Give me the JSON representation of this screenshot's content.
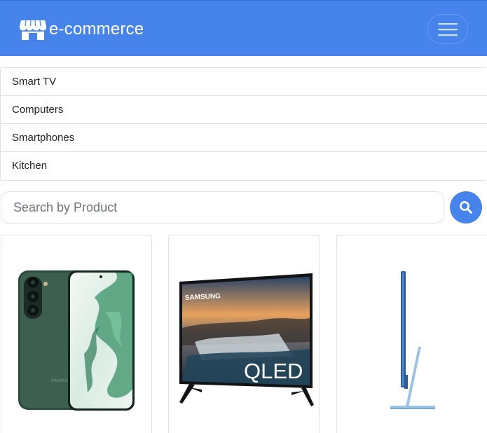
{
  "navbar": {
    "brand": "e-commerce",
    "brand_color": "#4683ea",
    "brand_icon": "storefront-icon",
    "menu_icon": "hamburger-menu-icon"
  },
  "categories": [
    "Smart TV",
    "Computers",
    "Smartphones",
    "Kitchen"
  ],
  "search": {
    "placeholder": "Search by Product",
    "button_icon": "search-icon"
  },
  "products": [
    {
      "image": "smartphone-image",
      "brand_text": "SAMSUNG"
    },
    {
      "image": "smart-tv-image",
      "brand_text": "SAMSUNG",
      "badge_text": "QLED"
    },
    {
      "image": "all-in-one-computer-image"
    }
  ]
}
